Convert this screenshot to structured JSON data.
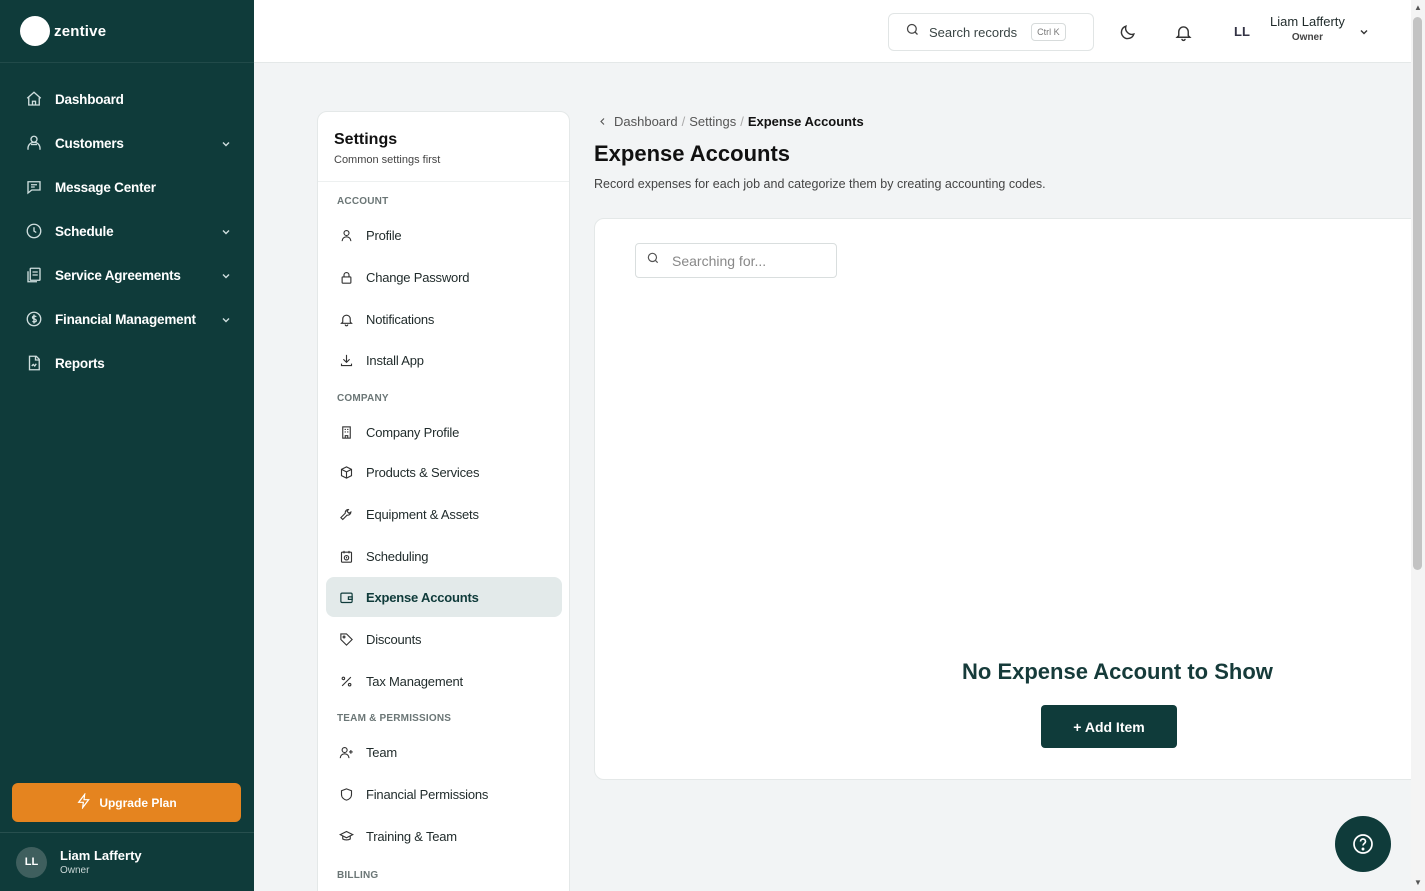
{
  "brand": {
    "name": "zentive"
  },
  "nav": {
    "items": [
      {
        "label": "Dashboard",
        "icon": "home-icon",
        "chevron": false
      },
      {
        "label": "Customers",
        "icon": "users-icon",
        "chevron": true
      },
      {
        "label": "Message Center",
        "icon": "chat-icon",
        "chevron": false
      },
      {
        "label": "Schedule",
        "icon": "clock-icon",
        "chevron": true
      },
      {
        "label": "Service Agreements",
        "icon": "agreements-icon",
        "chevron": true
      },
      {
        "label": "Financial Management",
        "icon": "dollar-icon",
        "chevron": true
      },
      {
        "label": "Reports",
        "icon": "report-icon",
        "chevron": false
      }
    ]
  },
  "upgrade": {
    "label": "Upgrade Plan"
  },
  "sidebar_user": {
    "initials": "LL",
    "name": "Liam Lafferty",
    "role": "Owner"
  },
  "topbar": {
    "search_label": "Search records",
    "shortcut": "Ctrl K",
    "initials": "LL",
    "user_name": "Liam Lafferty",
    "user_role": "Owner"
  },
  "settings": {
    "title": "Settings",
    "subtitle": "Common settings first",
    "sections": [
      {
        "label": "Account"
      },
      {
        "label": "Company"
      },
      {
        "label": "Team & Permissions"
      },
      {
        "label": "Billing"
      }
    ],
    "items": [
      {
        "label": "Profile",
        "icon": "user-icon"
      },
      {
        "label": "Change Password",
        "icon": "lock-icon"
      },
      {
        "label": "Notifications",
        "icon": "bell-icon"
      },
      {
        "label": "Install App",
        "icon": "download-icon"
      },
      {
        "label": "Company Profile",
        "icon": "building-icon"
      },
      {
        "label": "Products & Services",
        "icon": "box-icon"
      },
      {
        "label": "Equipment & Assets",
        "icon": "wrench-icon"
      },
      {
        "label": "Scheduling",
        "icon": "calendar-clock-icon"
      },
      {
        "label": "Expense Accounts",
        "icon": "wallet-icon",
        "active": true
      },
      {
        "label": "Discounts",
        "icon": "tag-icon"
      },
      {
        "label": "Tax Management",
        "icon": "percent-icon"
      },
      {
        "label": "Team",
        "icon": "user-plus-icon"
      },
      {
        "label": "Financial Permissions",
        "icon": "shield-icon"
      },
      {
        "label": "Training & Team",
        "icon": "graduation-icon"
      }
    ]
  },
  "breadcrumb": {
    "items": [
      "Dashboard",
      "Settings"
    ],
    "current": "Expense Accounts"
  },
  "page": {
    "title": "Expense Accounts",
    "description": "Record expenses for each job and categorize them by creating accounting codes."
  },
  "card": {
    "search_placeholder": "Searching for...",
    "empty_title": "No Expense Account to Show",
    "add_button": "+ Add Item"
  },
  "colors": {
    "sidebar": "#0f3b3a",
    "accent": "#e5841f",
    "primary": "#0f3b3a"
  }
}
